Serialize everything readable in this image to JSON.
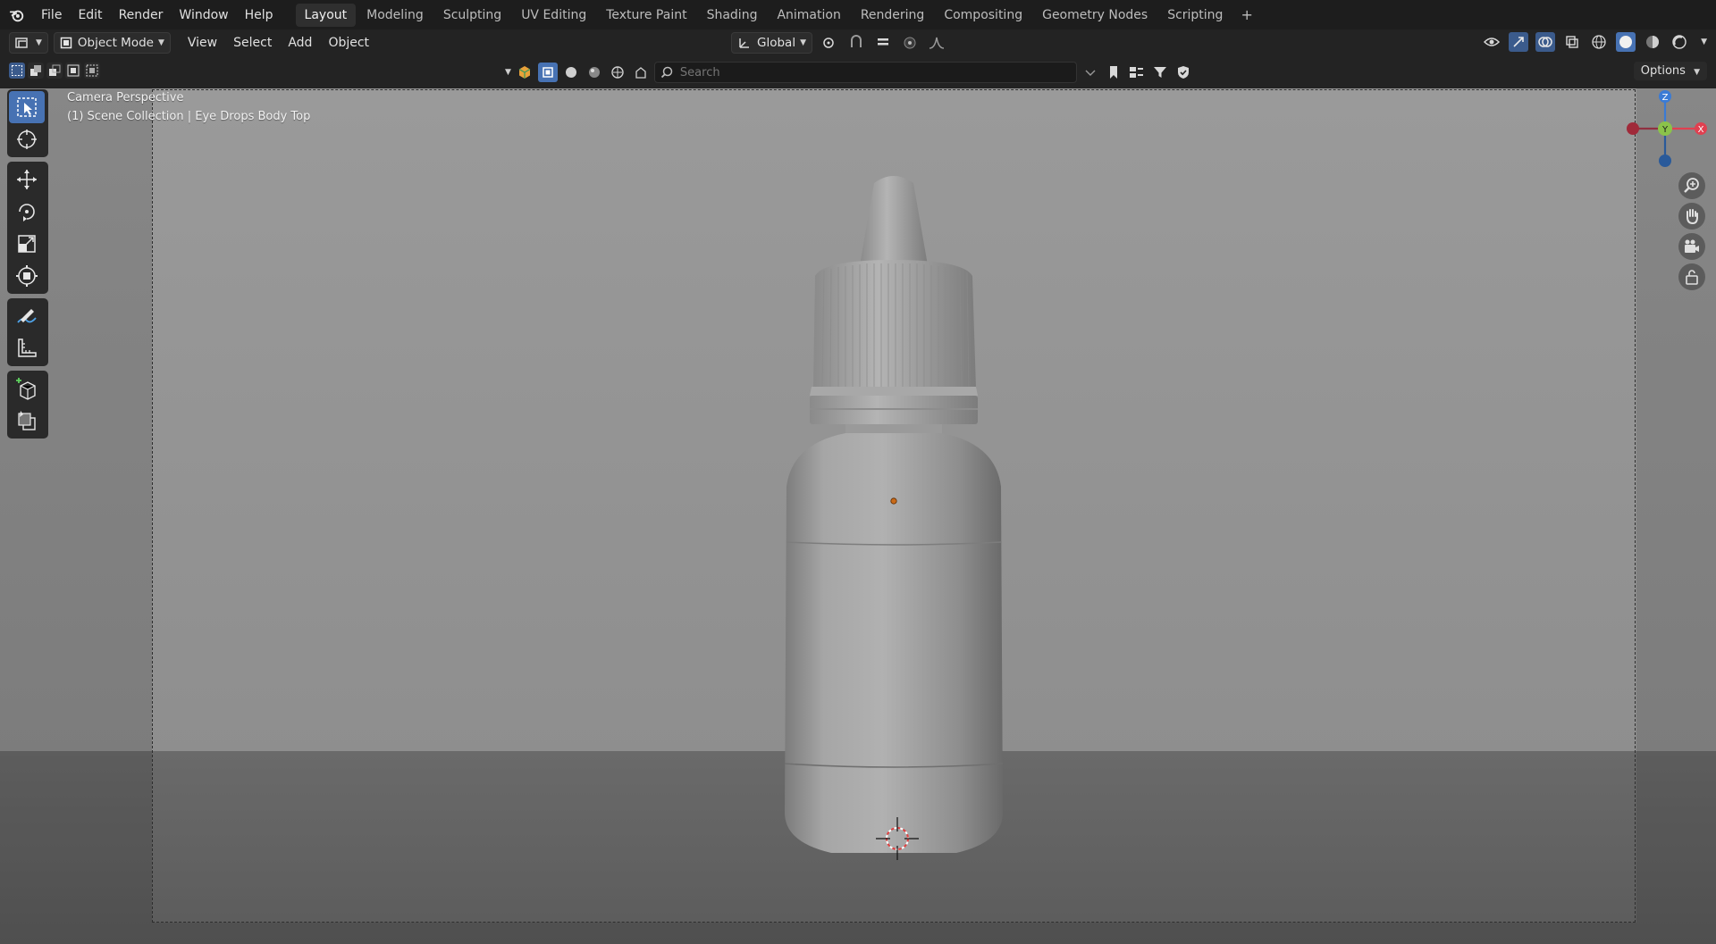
{
  "topbar": {
    "menus": [
      "File",
      "Edit",
      "Render",
      "Window",
      "Help"
    ],
    "workspaces": [
      "Layout",
      "Modeling",
      "Sculpting",
      "UV Editing",
      "Texture Paint",
      "Shading",
      "Animation",
      "Rendering",
      "Compositing",
      "Geometry Nodes",
      "Scripting"
    ],
    "active_workspace": "Layout",
    "add_label": "+"
  },
  "header": {
    "mode": "Object Mode",
    "menus": [
      "View",
      "Select",
      "Add",
      "Object"
    ],
    "orientation": "Global"
  },
  "toolrow": {
    "search_placeholder": "Search",
    "options_label": "Options"
  },
  "viewport": {
    "view_name": "Camera Perspective",
    "collection_info": "(1) Scene Collection | Eye Drops Body Top"
  },
  "gizmo": {
    "z_label": "Z",
    "y_label": "Y",
    "x_label": "X"
  },
  "colors": {
    "accent": "#4772b3",
    "axis_x": "#e04050",
    "axis_y": "#8bc34a",
    "axis_z": "#3a7bd5",
    "origin": "#ff8c1a"
  },
  "icons": {
    "toolbar": [
      "select-box-icon",
      "cursor-icon",
      "move-icon",
      "rotate-icon",
      "scale-icon",
      "transform-icon",
      "annotate-icon",
      "measure-icon",
      "add-cube-icon",
      "extrude-icon"
    ],
    "nav": [
      "zoom-icon",
      "pan-hand-icon",
      "camera-view-icon",
      "lock-icon"
    ]
  }
}
